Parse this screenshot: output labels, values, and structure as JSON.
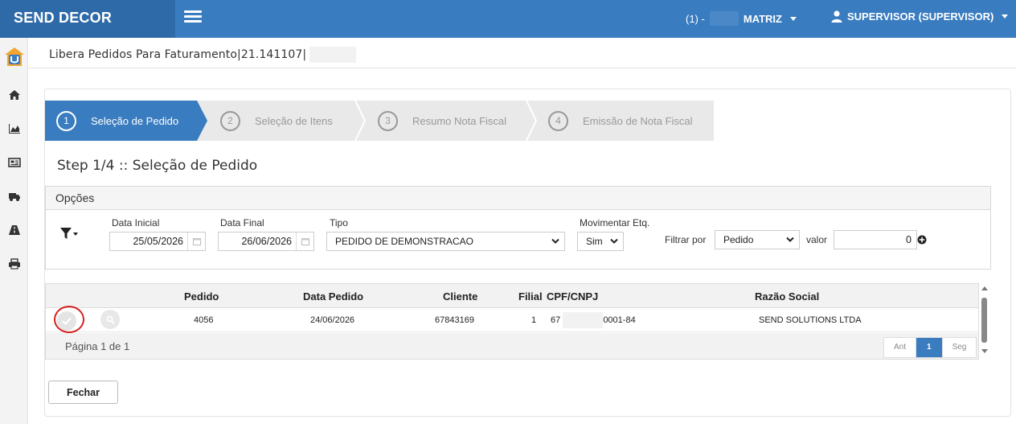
{
  "app": {
    "brand": "SEND DECOR"
  },
  "header": {
    "company_prefix": "(1) -",
    "company_name": "MATRIZ",
    "user": "SUPERVISOR (SUPERVISOR)"
  },
  "sidebar": {
    "items": [
      {
        "icon": "home-icon"
      },
      {
        "icon": "area-chart-icon"
      },
      {
        "icon": "newspaper-icon"
      },
      {
        "icon": "truck-icon"
      },
      {
        "icon": "road-icon"
      },
      {
        "icon": "print-icon"
      }
    ]
  },
  "breadcrumb": {
    "text": "Libera Pedidos Para Faturamento|21.141107|"
  },
  "wizard": {
    "steps": [
      {
        "number": "1",
        "label": "Seleção de Pedido",
        "active": true
      },
      {
        "number": "2",
        "label": "Seleção de Itens",
        "active": false
      },
      {
        "number": "3",
        "label": "Resumo Nota Fiscal",
        "active": false
      },
      {
        "number": "4",
        "label": "Emissão de Nota Fiscal",
        "active": false
      }
    ]
  },
  "step_title": "Step 1/4 :: Seleção de Pedido",
  "options": {
    "title": "Opções",
    "data_inicial": {
      "label": "Data Inicial",
      "value": "25/05/2026"
    },
    "data_final": {
      "label": "Data Final",
      "value": "26/06/2026"
    },
    "tipo": {
      "label": "Tipo",
      "value": "PEDIDO DE DEMONSTRACAO"
    },
    "movimentar": {
      "label": "Movimentar Etq.",
      "value": "Sim"
    },
    "filtrar_label": "Filtrar por",
    "filtrar_value": "Pedido",
    "valor_label": "valor",
    "valor_value": "0"
  },
  "table": {
    "headers": [
      "Pedido",
      "Data Pedido",
      "Cliente",
      "Filial",
      "CPF/CNPJ",
      "Razão Social"
    ],
    "rows": [
      {
        "pedido": "4056",
        "data": "24/06/2026",
        "cliente": "67843169",
        "filial": "1",
        "cpf_prefix": "67",
        "cpf_suffix": "0001-84",
        "razao": "SEND SOLUTIONS LTDA"
      }
    ],
    "page_label": "Página 1 de 1",
    "pager": {
      "prev": "Ant",
      "current": "1",
      "next": "Seg"
    }
  },
  "buttons": {
    "close": "Fechar"
  },
  "colors": {
    "primary": "#3a7cc0",
    "brand_bg": "#2f6aa8",
    "highlight_ring": "#d62020"
  }
}
